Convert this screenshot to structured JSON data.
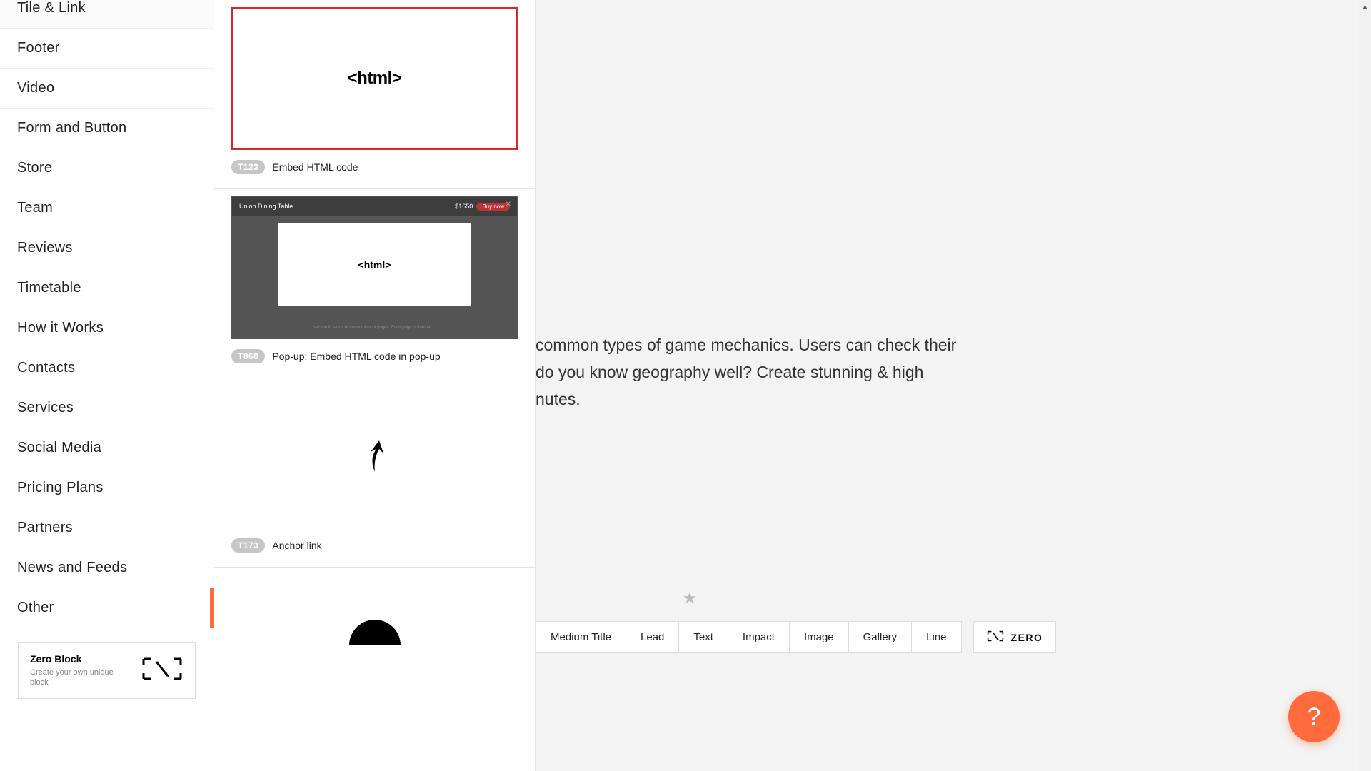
{
  "sidebar": {
    "items": [
      {
        "label": "Tile & Link",
        "active": false
      },
      {
        "label": "Footer",
        "active": false
      },
      {
        "label": "Video",
        "active": false
      },
      {
        "label": "Form and Button",
        "active": false
      },
      {
        "label": "Store",
        "active": false
      },
      {
        "label": "Team",
        "active": false
      },
      {
        "label": "Reviews",
        "active": false
      },
      {
        "label": "Timetable",
        "active": false
      },
      {
        "label": "How it Works",
        "active": false
      },
      {
        "label": "Contacts",
        "active": false
      },
      {
        "label": "Services",
        "active": false
      },
      {
        "label": "Social Media",
        "active": false
      },
      {
        "label": "Pricing Plans",
        "active": false
      },
      {
        "label": "Partners",
        "active": false
      },
      {
        "label": "News and Feeds",
        "active": false
      },
      {
        "label": "Other",
        "active": true
      }
    ],
    "zero_block": {
      "title": "Zero Block",
      "desc": "Create your own unique block"
    }
  },
  "blocks": [
    {
      "code": "T123",
      "title": "Embed HTML code",
      "preview": "html",
      "selected": true
    },
    {
      "code": "T868",
      "title": "Pop-up: Embed HTML code in pop-up",
      "preview": "popup",
      "selected": false,
      "popup_header_title": "Union Dining Table",
      "popup_price": "$1650",
      "popup_button": "Buy now",
      "popup_html_text": "<html>"
    },
    {
      "code": "T173",
      "title": "Anchor link",
      "preview": "anchor",
      "selected": false
    }
  ],
  "main": {
    "body_text": "common types of game mechanics. Users can check their do you know geography well? Create stunning & high nutes.",
    "body_line1": "common types of game mechanics. Users can check their",
    "body_line2": "do you know geography well? Create stunning & high",
    "body_line3": "nutes.",
    "star": "★"
  },
  "toolbar": {
    "buttons": [
      "Medium Title",
      "Lead",
      "Text",
      "Impact",
      "Image",
      "Gallery",
      "Line"
    ],
    "zero_label": "ZERO"
  },
  "help": {
    "label": "?"
  }
}
